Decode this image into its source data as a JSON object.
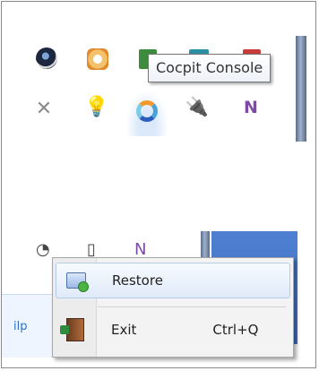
{
  "tray_top": {
    "row1": [
      "speaker-app-icon",
      "clock-app-icon",
      "green-app-icon",
      "teal-app-icon",
      "red-app-icon"
    ],
    "row2": [
      "mute-icon",
      "bulb-icon",
      "cocpit-ring-icon",
      "usb-check-icon",
      "onenote-clip-icon"
    ]
  },
  "tooltip": {
    "text": "Cocpit Console"
  },
  "context_menu": {
    "restore_label": "Restore",
    "exit_label": "Exit",
    "exit_shortcut": "Ctrl+Q"
  },
  "left_partial_text": "ilp"
}
